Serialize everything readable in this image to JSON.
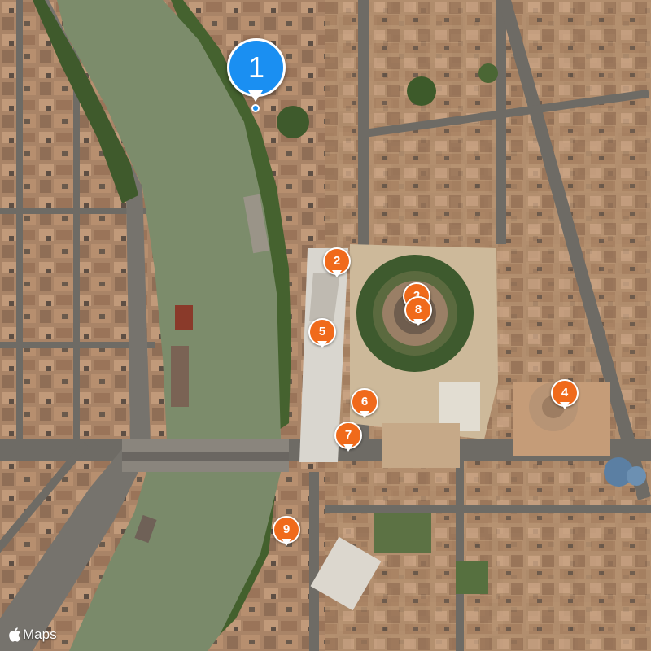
{
  "map": {
    "type": "satellite",
    "colors": {
      "river": "#7c8c6b",
      "roof": "#b08868",
      "street": "#6d6a64",
      "park": "#4d6a35",
      "pin_primary": "#1a8ff2",
      "pin_secondary": "#f06a1b"
    }
  },
  "markers": {
    "primary": {
      "label": "1"
    },
    "m2": {
      "label": "2"
    },
    "m3": {
      "label": "3"
    },
    "m4": {
      "label": "4"
    },
    "m5": {
      "label": "5"
    },
    "m6": {
      "label": "6"
    },
    "m7": {
      "label": "7"
    },
    "m8": {
      "label": "8"
    },
    "m9": {
      "label": "9"
    }
  },
  "attribution": {
    "logo_icon": "apple-logo-icon",
    "text": "Maps"
  }
}
